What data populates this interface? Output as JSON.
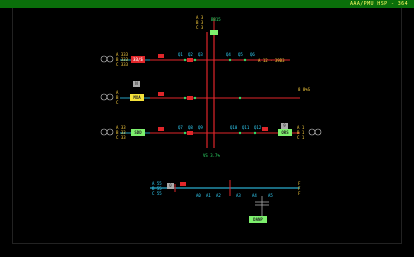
{
  "window": {
    "title": "AAA/PMU  HSP - 364",
    "accent": "#0a6f0a"
  },
  "diagram": {
    "center_label": "VS 3.7%",
    "feeders": {
      "f1": "33/S",
      "f2": "MXA",
      "f3": "SDD",
      "f4": "ORS",
      "f5": "DANP"
    },
    "left_tags": {
      "row1": [
        "A 333",
        "B 333",
        "C 333"
      ],
      "row2": [
        "A",
        "B",
        "C"
      ],
      "row3": [
        "A 33",
        "B 33",
        "C 33"
      ],
      "row4": [
        "A 55",
        "B 55",
        "C 55"
      ]
    },
    "right_tags": {
      "row1": "A 12 · 39B3",
      "row2": "8 8%S",
      "row3": [
        "A 1",
        "B 1",
        "C 1"
      ],
      "row4": [
        "F",
        "F",
        "F"
      ]
    },
    "top_labels": [
      "A 3",
      "B 3",
      "C 3"
    ],
    "top_tag": "ВВ15",
    "bus_labels": {
      "r1": [
        "Q1",
        "Q2",
        "Q3",
        "Q4",
        "Q5",
        "Q6"
      ],
      "r3": [
        "Q7",
        "Q8",
        "Q9",
        "Q10",
        "Q11",
        "Q12"
      ],
      "bottom": [
        "A0",
        "A1",
        "A2",
        "A3",
        "A4",
        "A5"
      ]
    },
    "grey_marks": [
      "N",
      "9",
      "0"
    ]
  }
}
